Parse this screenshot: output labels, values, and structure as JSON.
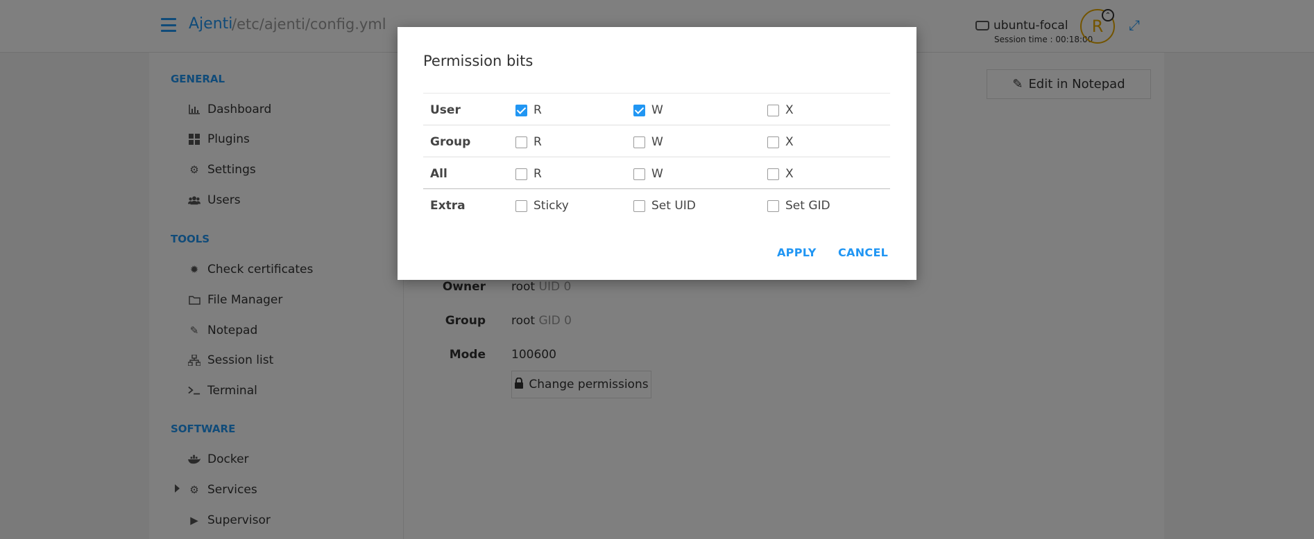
{
  "header": {
    "brand": "Ajenti",
    "path": "/etc/ajenti/config.yml",
    "hostname": "ubuntu-focal",
    "session_time": "Session time : 00:18:00",
    "avatar_letter": "R"
  },
  "sidebar": {
    "sections": [
      {
        "title": "GENERAL",
        "items": [
          {
            "label": "Dashboard",
            "icon": "chart-icon"
          },
          {
            "label": "Plugins",
            "icon": "grid-icon"
          },
          {
            "label": "Settings",
            "icon": "gear-icon"
          },
          {
            "label": "Users",
            "icon": "users-icon"
          }
        ]
      },
      {
        "title": "TOOLS",
        "items": [
          {
            "label": "Check certificates",
            "icon": "certificate-icon"
          },
          {
            "label": "File Manager",
            "icon": "folder-icon"
          },
          {
            "label": "Notepad",
            "icon": "pencil-icon"
          },
          {
            "label": "Session list",
            "icon": "sitemap-icon"
          },
          {
            "label": "Terminal",
            "icon": "terminal-icon"
          }
        ]
      },
      {
        "title": "SOFTWARE",
        "items": [
          {
            "label": "Docker",
            "icon": "docker-icon"
          },
          {
            "label": "Services",
            "icon": "cogs-icon"
          },
          {
            "label": "Supervisor",
            "icon": "play-icon"
          }
        ]
      }
    ]
  },
  "main": {
    "edit_button": "Edit in Notepad",
    "owner": {
      "label": "Owner",
      "name": "root",
      "id": "UID 0"
    },
    "group": {
      "label": "Group",
      "name": "root",
      "id": "GID 0"
    },
    "mode": {
      "label": "Mode",
      "value": "100600"
    },
    "change_permissions": "Change permissions"
  },
  "modal": {
    "title": "Permission bits",
    "rows": [
      {
        "label": "User",
        "cells": [
          {
            "label": "R",
            "checked": true
          },
          {
            "label": "W",
            "checked": true
          },
          {
            "label": "X",
            "checked": false
          }
        ]
      },
      {
        "label": "Group",
        "cells": [
          {
            "label": "R",
            "checked": false
          },
          {
            "label": "W",
            "checked": false
          },
          {
            "label": "X",
            "checked": false
          }
        ]
      },
      {
        "label": "All",
        "cells": [
          {
            "label": "R",
            "checked": false
          },
          {
            "label": "W",
            "checked": false
          },
          {
            "label": "X",
            "checked": false
          }
        ]
      },
      {
        "label": "Extra",
        "cells": [
          {
            "label": "Sticky",
            "checked": false
          },
          {
            "label": "Set UID",
            "checked": false
          },
          {
            "label": "Set GID",
            "checked": false
          }
        ]
      }
    ],
    "apply": "APPLY",
    "cancel": "CANCEL"
  },
  "colors": {
    "accent": "#2196f3",
    "avatar": "#e6a800",
    "overlay": "rgba(0,0,0,0.5)"
  }
}
